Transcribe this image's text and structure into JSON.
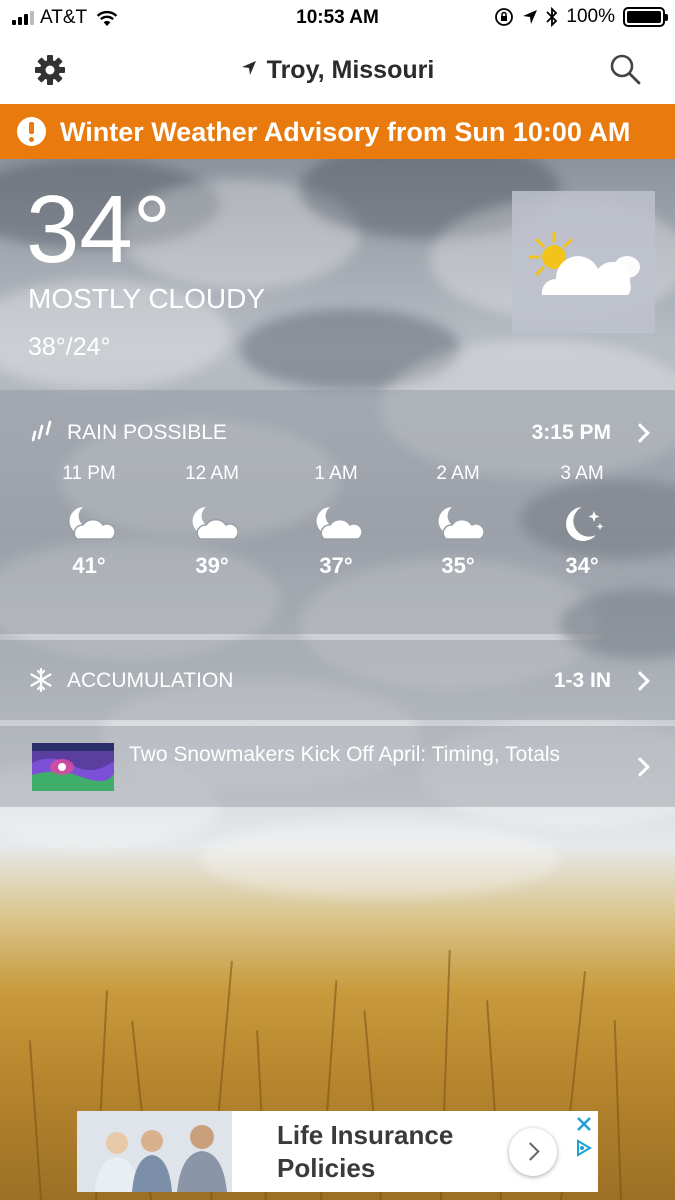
{
  "status_bar": {
    "carrier": "AT&T",
    "time": "10:53 AM",
    "battery": "100%"
  },
  "nav": {
    "location": "Troy, Missouri"
  },
  "advisory": {
    "text": "Winter Weather Advisory from Sun 10:00 AM"
  },
  "current": {
    "temperature": "34°",
    "condition": "MOSTLY CLOUDY",
    "hi_lo": "38°/24°",
    "icon": "partly-cloudy-sun-icon"
  },
  "precip": {
    "title": "RAIN POSSIBLE",
    "time": "3:15 PM",
    "hours": [
      {
        "label": "11 PM",
        "temp": "41°",
        "icon": "night-cloudy-icon"
      },
      {
        "label": "12 AM",
        "temp": "39°",
        "icon": "night-cloudy-icon"
      },
      {
        "label": "1 AM",
        "temp": "37°",
        "icon": "night-cloudy-icon"
      },
      {
        "label": "2 AM",
        "temp": "35°",
        "icon": "night-cloudy-icon"
      },
      {
        "label": "3 AM",
        "temp": "34°",
        "icon": "moon-stars-icon"
      }
    ]
  },
  "accumulation": {
    "title": "ACCUMULATION",
    "value": "1-3 IN"
  },
  "news": {
    "title": "Two Snowmakers Kick Off April: Timing, Totals"
  },
  "ad": {
    "title": "Life Insurance Policies"
  },
  "colors": {
    "advisory": "#e87a0e",
    "panel": "rgba(140,145,155,0.42)"
  }
}
